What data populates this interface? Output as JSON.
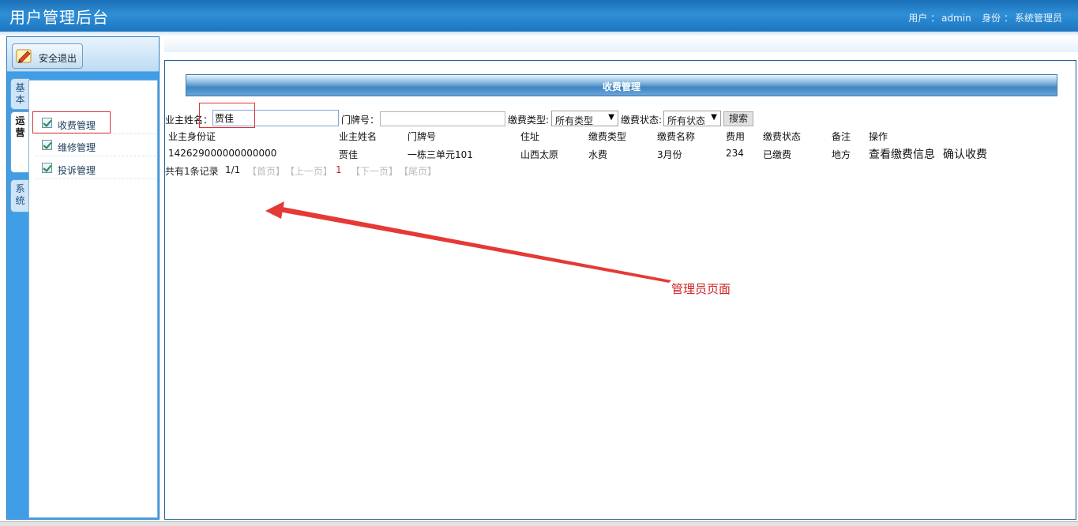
{
  "header": {
    "title": "用户管理后台",
    "user_label": "用户 ：",
    "user_name": "admin",
    "role_label": "身份 ：",
    "role_name": "系统管理员"
  },
  "sidebar": {
    "logout_label": "安全退出",
    "tabs": [
      {
        "label": "基\n本"
      },
      {
        "label": "运\n营"
      },
      {
        "label": "系\n统"
      }
    ],
    "menu_items": [
      {
        "label": "收费管理"
      },
      {
        "label": "维修管理"
      },
      {
        "label": "投诉管理"
      }
    ]
  },
  "main": {
    "section_title": "收费管理",
    "search": {
      "owner_name_label": "业主姓名：",
      "owner_name_value": "贾佳",
      "door_number_label": "门牌号：",
      "door_number_value": "",
      "fee_type_label": "缴费类型:",
      "fee_type_selected": "所有类型",
      "fee_status_label": "缴费状态:",
      "fee_status_selected": "所有状态",
      "search_button": "搜索"
    },
    "table": {
      "columns": [
        "业主身份证",
        "业主姓名",
        "门牌号",
        "住址",
        "缴费类型",
        "缴费名称",
        "费用",
        "缴费状态",
        "备注",
        "操作"
      ],
      "rows": [
        {
          "id_card": "142629000000000000",
          "owner_name": "贾佳",
          "door_number": "一栋三单元101",
          "address": "山西太原",
          "fee_type": "水费",
          "fee_name": "3月份",
          "fee": "234",
          "status": "已缴费",
          "remark": "地方",
          "op_view": "查看缴费信息",
          "op_confirm": "确认收费"
        }
      ]
    },
    "pagination": {
      "summary": "共有1条记录",
      "page_info": "1/1",
      "first": "【首页】",
      "prev": "【上一页】",
      "current": "1",
      "next": "【下一页】",
      "last": "【尾页】"
    }
  },
  "annotation": {
    "text": "管理员页面",
    "color": "#cc2020"
  }
}
